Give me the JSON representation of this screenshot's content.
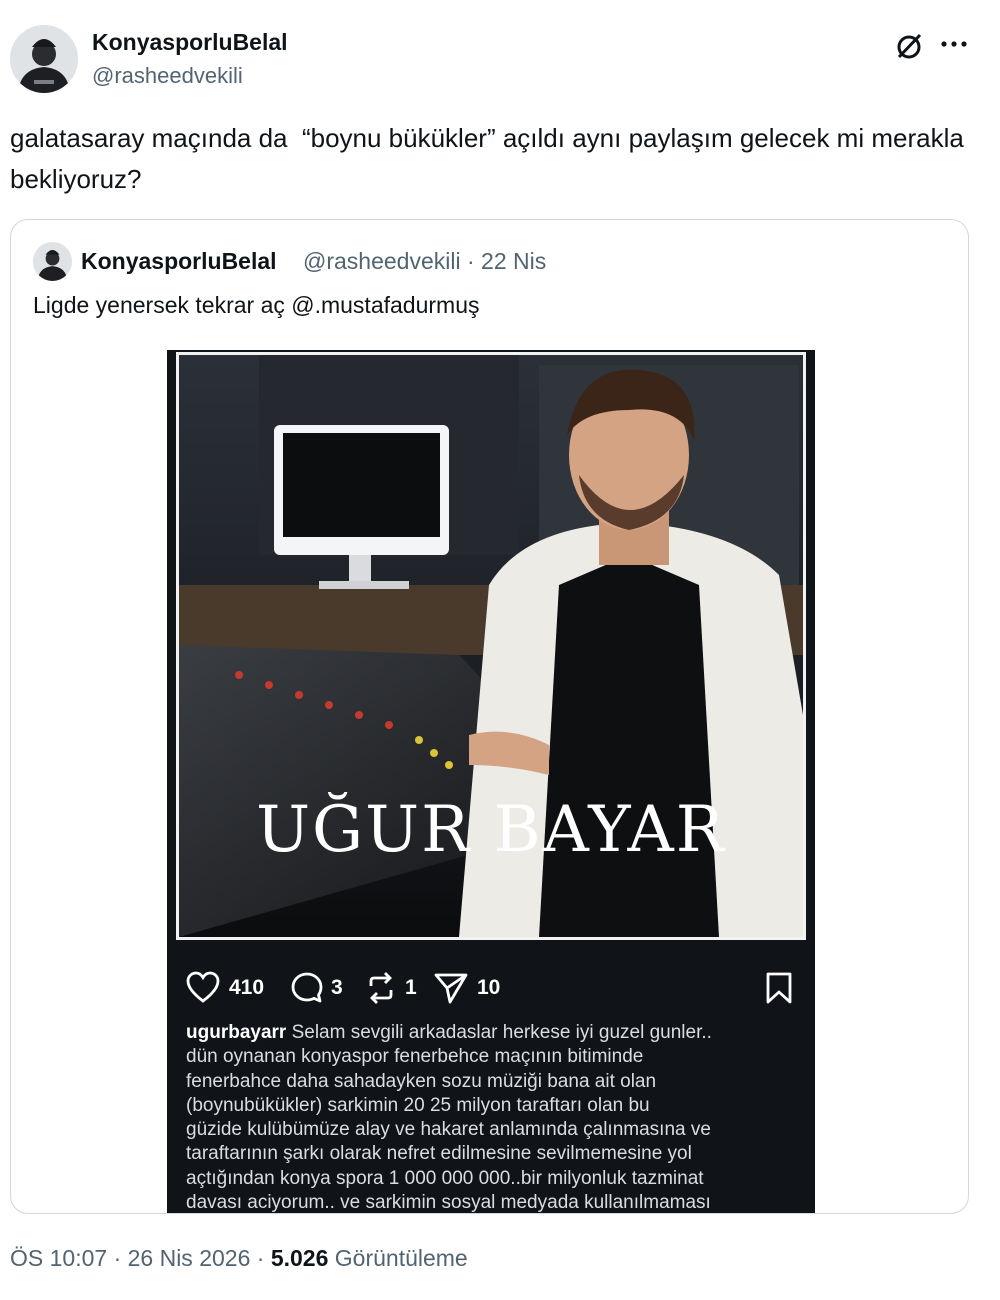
{
  "tweet": {
    "author": {
      "display_name": "KonyasporluBelal",
      "handle": "@rasheedvekili"
    },
    "text": "galatasaray maçında da  “boynu bükükler” açıldı aynı paylaşım gelecek mi merakla bekliyoruz?",
    "timestamp": "ÖS 10:07 · 26 Nis 2026 ·",
    "views_count": "5.026",
    "views_label": "Görüntüleme"
  },
  "quote": {
    "author": {
      "display_name": "KonyasporluBelal",
      "handle": "@rasheedvekili",
      "separator": "·",
      "date": "22 Nis"
    },
    "text": "Ligde yenersek tekrar aç @.mustafadurmuş"
  },
  "embedded_post": {
    "photo_title": "UĞUR BAYAR",
    "likes": "410",
    "comments": "3",
    "reposts": "1",
    "shares": "10",
    "caption_user": "ugurbayarr",
    "caption_text": "Selam sevgili arkadaslar herkese iyi guzel gunler..\ndün oynanan konyaspor fenerbehce maçının  bitiminde\nfenerbahce daha sahadayken  sozu müziği bana ait olan\n(boynubükükler) sarkimin  20 25 milyon  taraftarı olan bu\ngüzide  kulübümüze alay ve hakaret anlamında çalınmasına ve\ntaraftarının şarkı olarak nefret edilmesine sevilmemesine yol\naçtığından  konya spora 1 000 000 000..bir milyonluk tazminat\ndavası aciyorum.. ve sarkimin sosyal medyada kullanılmaması"
  },
  "icons": {
    "grok": "grok-icon",
    "more": "more-icon",
    "like": "heart-icon",
    "comment": "comment-bubble-icon",
    "repost": "repost-icon",
    "share": "send-icon",
    "save": "bookmark-icon"
  },
  "colors": {
    "text": "#0f1419",
    "secondary": "#536471",
    "border": "#cfd9de",
    "media_bg": "#101318"
  }
}
